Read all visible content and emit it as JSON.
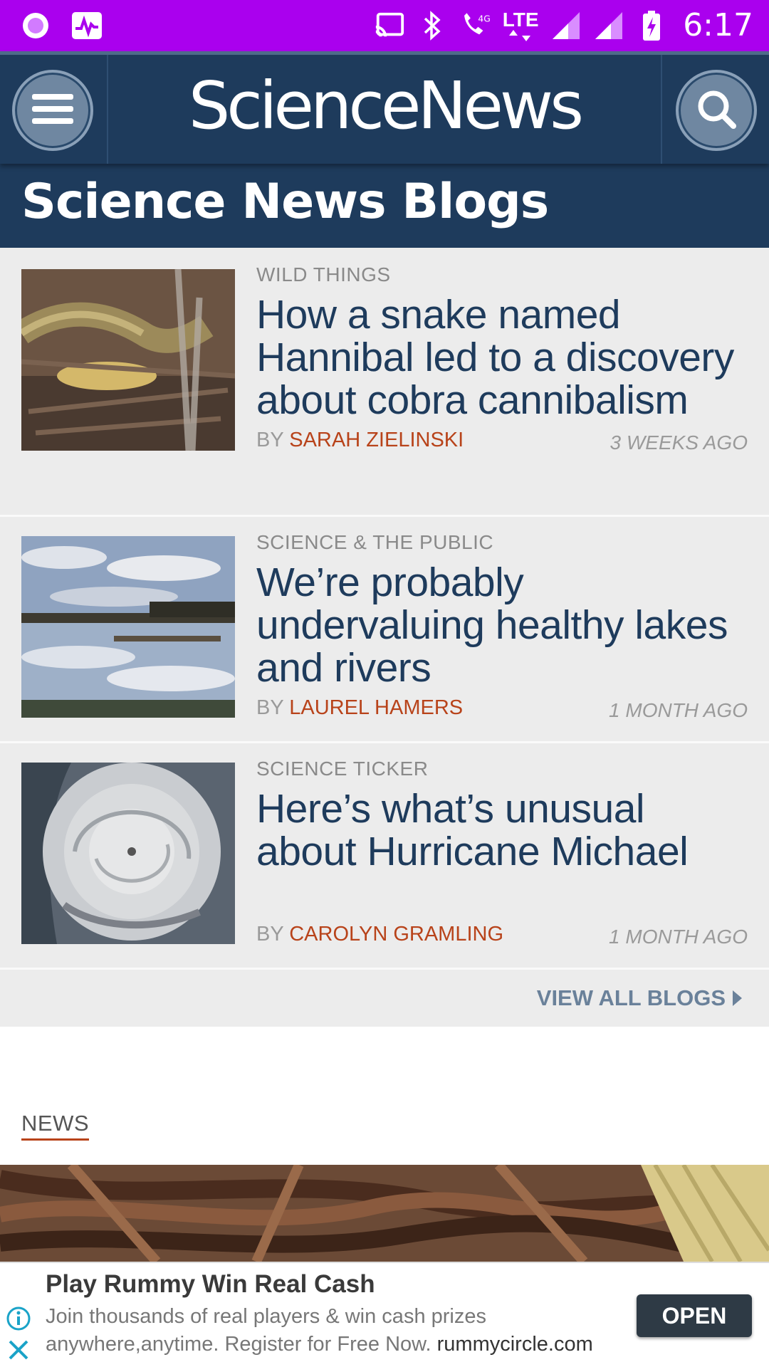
{
  "status_bar": {
    "time": "6:17",
    "network_label_top": "LTE",
    "network_label_small": "4G",
    "icons": [
      "podcast-icon",
      "activity-icon",
      "cast-icon",
      "bluetooth-icon",
      "wifi-calling-icon",
      "lte-icon",
      "signal-icon",
      "signal-icon",
      "battery-charging-icon"
    ]
  },
  "header": {
    "brand": "ScienceNews",
    "menu_icon": "hamburger-menu-icon",
    "search_icon": "search-icon",
    "background": "#1e3b5c"
  },
  "blogs_section": {
    "title": "Science News Blogs",
    "items": [
      {
        "category": "WILD THINGS",
        "title": "How a snake named Hannibal led to a discovery about cobra cannibalism",
        "by_label": "BY",
        "author": "SARAH ZIELINSKI",
        "time": "3 WEEKS AGO",
        "image": "snake-photo"
      },
      {
        "category": "SCIENCE & THE PUBLIC",
        "title": "We’re probably undervaluing healthy lakes and rivers",
        "by_label": "BY",
        "author": "LAUREL HAMERS",
        "time": "1 MONTH AGO",
        "image": "lake-photo"
      },
      {
        "category": "SCIENCE TICKER",
        "title": "Here’s what’s unusual about Hurricane Michael",
        "by_label": "BY",
        "author": "CAROLYN GRAMLING",
        "time": "1 MONTH AGO",
        "image": "hurricane-photo"
      }
    ],
    "view_all": "VIEW ALL BLOGS"
  },
  "news_section": {
    "label": "NEWS"
  },
  "ad": {
    "title": "Play Rummy Win Real Cash",
    "description": "Join thousands of real players & win cash prizes anywhere,anytime. Register for Free Now.",
    "domain": "rummycircle.com",
    "button": "OPEN"
  },
  "colors": {
    "status_bar": "#aa00ee",
    "brand_navy": "#1e3b5c",
    "author_accent": "#b8431a",
    "list_background": "#ececec"
  }
}
